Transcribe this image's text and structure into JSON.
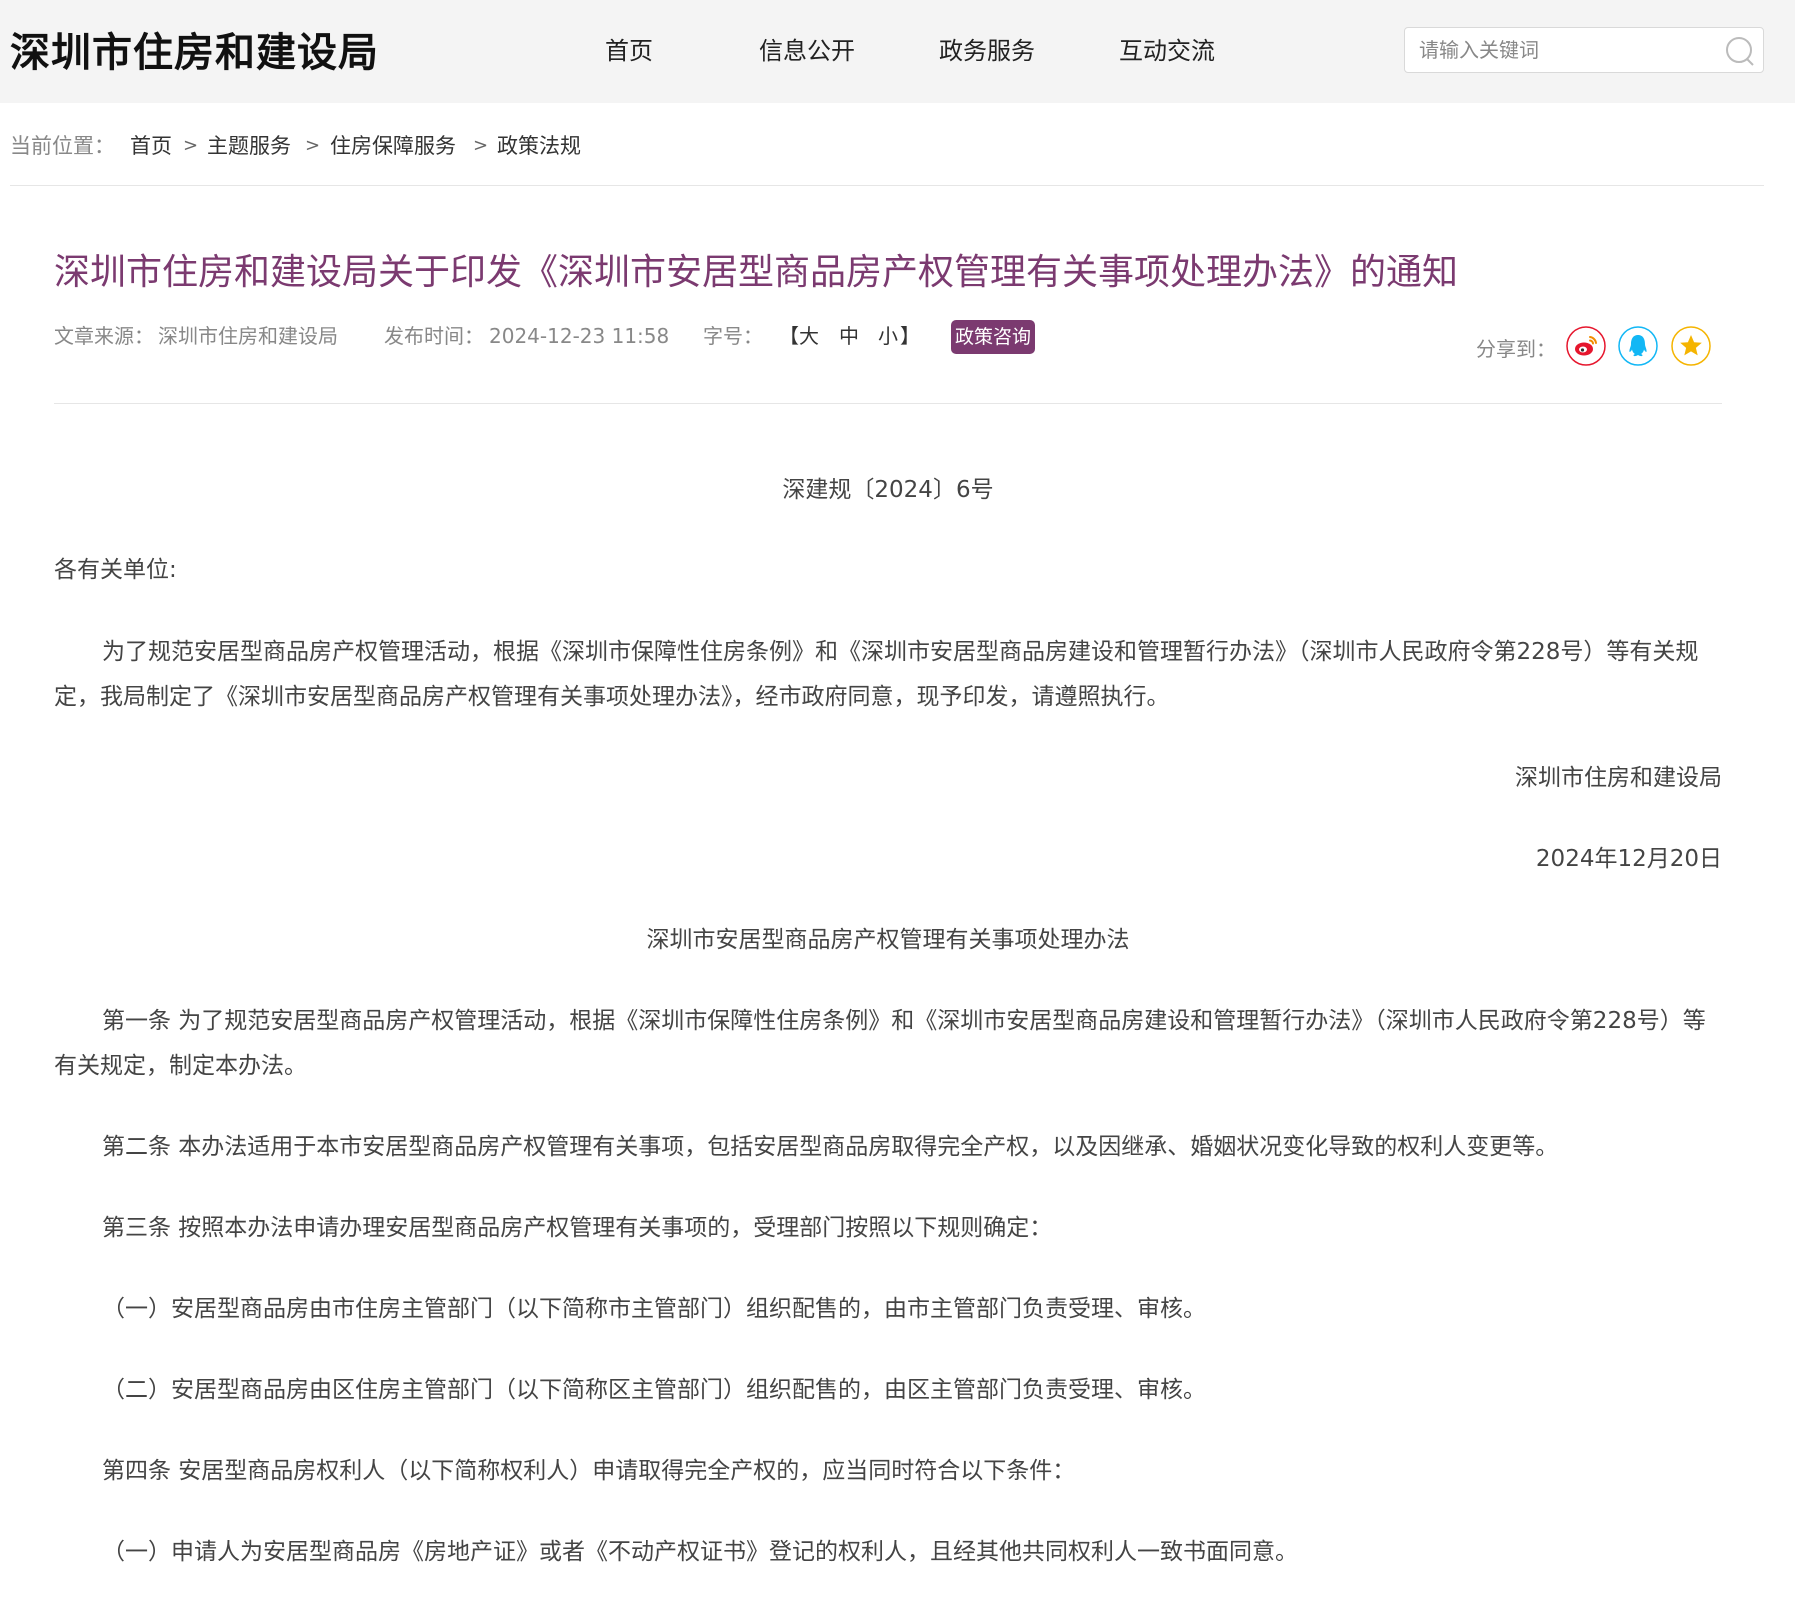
{
  "header": {
    "site_title": "深圳市住房和建设局",
    "nav": [
      "首页",
      "信息公开",
      "政务服务",
      "互动交流"
    ],
    "search_placeholder": "请输入关键词"
  },
  "breadcrumb": {
    "label": "当前位置：",
    "items": [
      "首页",
      "主题服务",
      "住房保障服务",
      "政策法规"
    ],
    "separator": ">"
  },
  "article": {
    "title": "深圳市住房和建设局关于印发《深圳市安居型商品房产权管理有关事项处理办法》的通知",
    "source_label": "文章来源：",
    "source": "深圳市住房和建设局",
    "time_label": "发布时间：",
    "time": "2024-12-23 11:58",
    "font_label": "字号：",
    "font_open": "【",
    "font_sizes": [
      "大",
      "中",
      "小"
    ],
    "font_close": "】",
    "badge": "政策咨询",
    "share_label": "分享到："
  },
  "share_icons": [
    "weibo-icon",
    "qq-icon",
    "favorite-star-icon"
  ],
  "colors": {
    "accent": "#7b3a70",
    "header_bg": "#f4f4f4",
    "weibo": "#e6162d",
    "qq": "#12b7f5",
    "star": "#f5b400"
  },
  "body": {
    "doc_number": "深建规〔2024〕6号",
    "salutation": "各有关单位:",
    "intro": "为了规范安居型商品房产权管理活动，根据《深圳市保障性住房条例》和《深圳市安居型商品房建设和管理暂行办法》（深圳市人民政府令第228号）等有关规定，我局制定了《深圳市安居型商品房产权管理有关事项处理办法》，经市政府同意，现予印发，请遵照执行。",
    "signer": "深圳市住房和建设局",
    "date": "2024年12月20日",
    "subtitle": "深圳市安居型商品房产权管理有关事项处理办法",
    "article1": "第一条 为了规范安居型商品房产权管理活动，根据《深圳市保障性住房条例》和《深圳市安居型商品房建设和管理暂行办法》（深圳市人民政府令第228号）等有关规定，制定本办法。",
    "article2": "第二条 本办法适用于本市安居型商品房产权管理有关事项，包括安居型商品房取得完全产权，以及因继承、婚姻状况变化导致的权利人变更等。",
    "article3": "第三条 按照本办法申请办理安居型商品房产权管理有关事项的，受理部门按照以下规则确定：",
    "article3_item1": "（一）安居型商品房由市住房主管部门（以下简称市主管部门）组织配售的，由市主管部门负责受理、审核。",
    "article3_item2": "（二）安居型商品房由区住房主管部门（以下简称区主管部门）组织配售的，由区主管部门负责受理、审核。",
    "article4": "第四条 安居型商品房权利人（以下简称权利人）申请取得完全产权的，应当同时符合以下条件：",
    "article4_item1": "（一）申请人为安居型商品房《房地产证》或者《不动产权证书》登记的权利人，且经其他共同权利人一致书面同意。"
  }
}
